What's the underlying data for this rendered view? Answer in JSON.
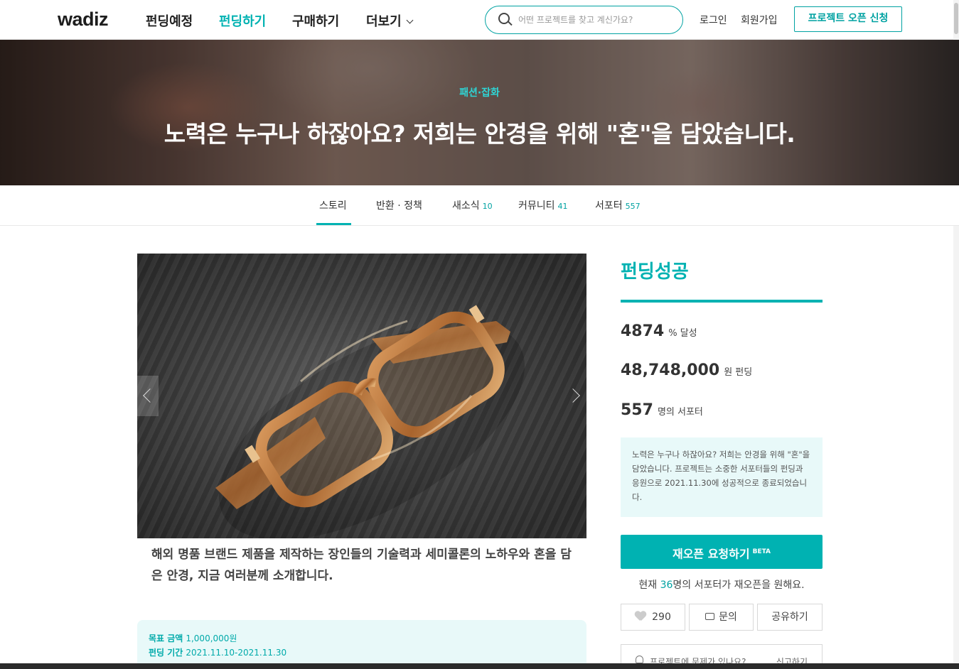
{
  "nav": {
    "logo": "wadiz",
    "items": [
      {
        "label": "펀딩예정"
      },
      {
        "label": "펀딩하기"
      },
      {
        "label": "구매하기"
      },
      {
        "label": "더보기"
      }
    ],
    "search_placeholder": "어떤 프로젝트를 찾고 계신가요?",
    "login": "로그인",
    "signup": "회원가입",
    "open_project": "프로젝트 오픈 신청"
  },
  "hero": {
    "category": "패션·잡화",
    "title": "노력은 누구나 하잖아요? 저희는 안경을 위해 \"혼\"을 담았습니다."
  },
  "tabs": [
    {
      "label": "스토리",
      "count": ""
    },
    {
      "label": "반환 · 정책",
      "count": ""
    },
    {
      "label": "새소식",
      "count": "10"
    },
    {
      "label": "커뮤니티",
      "count": "41"
    },
    {
      "label": "서포터",
      "count": "557"
    }
  ],
  "story": {
    "summary": "해외 명품 브랜드 제품을 제작하는 장인들의 기술력과 세미콜론의 노하우와 혼을 담은 안경, 지금 여러분께 소개합니다.",
    "goal_label": "목표 금액",
    "goal_value": "1,000,000원",
    "period_label": "펀딩 기간",
    "period_value": "2021.11.10-2021.11.30"
  },
  "panel": {
    "status": "펀딩성공",
    "rate": "4874",
    "rate_unit": "% 달성",
    "amount": "48,748,000",
    "amount_unit": "원 펀딩",
    "supporters": "557",
    "supporters_unit": "명의 서포터",
    "notice": "노력은 누구나 하잖아요? 저희는 안경을 위해 \"혼\"을 담았습니다. 프로젝트는 소중한 서포터들의 펀딩과 응원으로 2021.11.30에 성공적으로 종료되었습니다.",
    "reopen_label": "재오픈 요청하기",
    "reopen_badge": "BETA",
    "reopen_prefix": "현재 ",
    "reopen_count": "36",
    "reopen_suffix": "명의 서포터가 재오픈을 원해요.",
    "like_count": "290",
    "inquiry": "문의",
    "share": "공유하기",
    "report_text": "프로젝트에 문제가 있나요?",
    "report_link": "신고하기"
  },
  "colors": {
    "accent": "#00b2b2",
    "light_bg": "#e8f9f9"
  }
}
